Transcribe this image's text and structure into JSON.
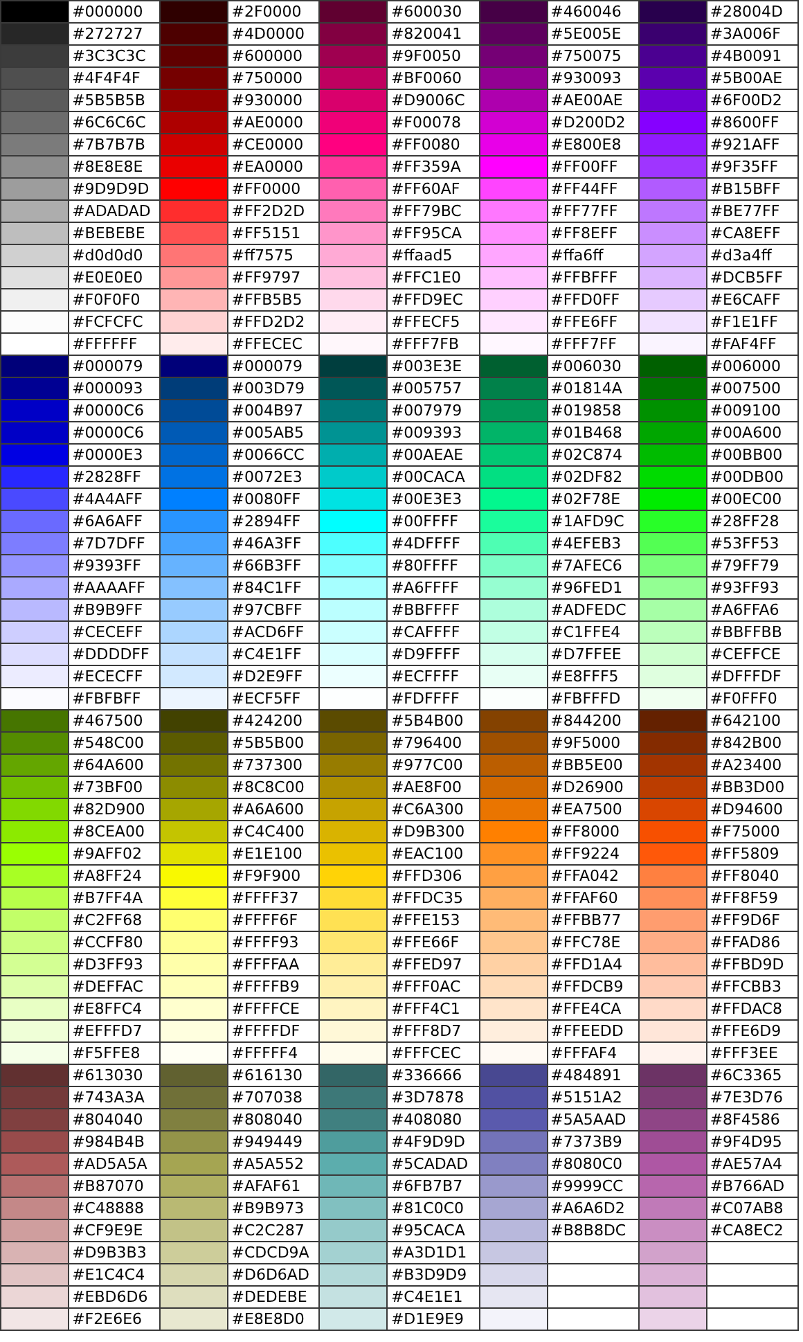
{
  "rows": [
    {
      "cells": [
        {
          "color": "#000000",
          "hex": "#000000"
        },
        {
          "color": "#2f0000",
          "hex": "#2F0000"
        },
        {
          "color": "#600030",
          "hex": "#600030"
        },
        {
          "color": "#460046",
          "hex": "#460046"
        },
        {
          "color": "#28004d",
          "hex": "#28004D"
        }
      ]
    },
    {
      "cells": [
        {
          "color": "#272727",
          "hex": "#272727"
        },
        {
          "color": "#4d0000",
          "hex": "#4D0000"
        },
        {
          "color": "#820041",
          "hex": "#820041"
        },
        {
          "color": "#5e005e",
          "hex": "#5E005E"
        },
        {
          "color": "#3a006f",
          "hex": "#3A006F"
        }
      ]
    },
    {
      "cells": [
        {
          "color": "#3c3c3c",
          "hex": "#3C3C3C"
        },
        {
          "color": "#600000",
          "hex": "#600000"
        },
        {
          "color": "#9f0050",
          "hex": "#9F0050"
        },
        {
          "color": "#750075",
          "hex": "#750075"
        },
        {
          "color": "#4b0091",
          "hex": "#4B0091"
        }
      ]
    },
    {
      "cells": [
        {
          "color": "#4f4f4f",
          "hex": "#4F4F4F"
        },
        {
          "color": "#750000",
          "hex": "#750000"
        },
        {
          "color": "#bf0060",
          "hex": "#BF0060"
        },
        {
          "color": "#930093",
          "hex": "#930093"
        },
        {
          "color": "#5b00ae",
          "hex": "#5B00AE"
        }
      ]
    },
    {
      "cells": [
        {
          "color": "#5b5b5b",
          "hex": "#5B5B5B"
        },
        {
          "color": "#930000",
          "hex": "#930000"
        },
        {
          "color": "#d9006c",
          "hex": "#D9006C"
        },
        {
          "color": "#ae00ae",
          "hex": "#AE00AE"
        },
        {
          "color": "#6f00d2",
          "hex": "#6F00D2"
        }
      ]
    },
    {
      "cells": [
        {
          "color": "#6c6c6c",
          "hex": "#6C6C6C"
        },
        {
          "color": "#ae0000",
          "hex": "#AE0000"
        },
        {
          "color": "#f00078",
          "hex": "#F00078"
        },
        {
          "color": "#d200d2",
          "hex": "#D200D2"
        },
        {
          "color": "#8600ff",
          "hex": "#8600FF"
        }
      ]
    },
    {
      "cells": [
        {
          "color": "#7b7b7b",
          "hex": "#7B7B7B"
        },
        {
          "color": "#ce0000",
          "hex": "#CE0000"
        },
        {
          "color": "#ff0080",
          "hex": "#FF0080"
        },
        {
          "color": "#e800e8",
          "hex": "#E800E8"
        },
        {
          "color": "#921aff",
          "hex": "#921AFF"
        }
      ]
    },
    {
      "cells": [
        {
          "color": "#8e8e8e",
          "hex": "#8E8E8E"
        },
        {
          "color": "#ea0000",
          "hex": "#EA0000"
        },
        {
          "color": "#ff359a",
          "hex": "#FF359A"
        },
        {
          "color": "#ff00ff",
          "hex": "#FF00FF"
        },
        {
          "color": "#9f35ff",
          "hex": "#9F35FF"
        }
      ]
    },
    {
      "cells": [
        {
          "color": "#9d9d9d",
          "hex": "#9D9D9D"
        },
        {
          "color": "#ff0000",
          "hex": "#FF0000"
        },
        {
          "color": "#ff60af",
          "hex": "#FF60AF"
        },
        {
          "color": "#ff44ff",
          "hex": "#FF44FF"
        },
        {
          "color": "#b15bff",
          "hex": "#B15BFF"
        }
      ]
    },
    {
      "cells": [
        {
          "color": "#adadad",
          "hex": "#ADADAD"
        },
        {
          "color": "#ff2d2d",
          "hex": "#FF2D2D"
        },
        {
          "color": "#ff79bc",
          "hex": "#FF79BC"
        },
        {
          "color": "#ff77ff",
          "hex": "#FF77FF"
        },
        {
          "color": "#be77ff",
          "hex": "#BE77FF"
        }
      ]
    },
    {
      "cells": [
        {
          "color": "#bebebe",
          "hex": "#BEBEBE"
        },
        {
          "color": "#ff5151",
          "hex": "#FF5151"
        },
        {
          "color": "#ff95ca",
          "hex": "#FF95CA"
        },
        {
          "color": "#ff8eff",
          "hex": "#FF8EFF"
        },
        {
          "color": "#ca8eff",
          "hex": "#CA8EFF"
        }
      ]
    },
    {
      "cells": [
        {
          "color": "#d0d0d0",
          "hex": "#d0d0d0"
        },
        {
          "color": "#ff7575",
          "hex": "#ff7575"
        },
        {
          "color": "#ffaad5",
          "hex": "#ffaad5"
        },
        {
          "color": "#ffa6ff",
          "hex": "#ffa6ff"
        },
        {
          "color": "#d3a4ff",
          "hex": "#d3a4ff"
        }
      ]
    },
    {
      "cells": [
        {
          "color": "#e0e0e0",
          "hex": "#E0E0E0"
        },
        {
          "color": "#ff9797",
          "hex": "#FF9797"
        },
        {
          "color": "#ffc1e0",
          "hex": "#FFC1E0"
        },
        {
          "color": "#ffbfff",
          "hex": "#FFBFFF"
        },
        {
          "color": "#dcb5ff",
          "hex": "#DCB5FF"
        }
      ]
    },
    {
      "cells": [
        {
          "color": "#f0f0f0",
          "hex": "#F0F0F0"
        },
        {
          "color": "#ffb5b5",
          "hex": "#FFB5B5"
        },
        {
          "color": "#ffd9ec",
          "hex": "#FFD9EC"
        },
        {
          "color": "#ffd0ff",
          "hex": "#FFD0FF"
        },
        {
          "color": "#e6caff",
          "hex": "#E6CAFF"
        }
      ]
    },
    {
      "cells": [
        {
          "color": "#fcfcfc",
          "hex": "#FCFCFC"
        },
        {
          "color": "#ffd2d2",
          "hex": "#FFD2D2"
        },
        {
          "color": "#ffecf5",
          "hex": "#FFECF5"
        },
        {
          "color": "#ffe6ff",
          "hex": "#FFE6FF"
        },
        {
          "color": "#f1e1ff",
          "hex": "#F1E1FF"
        }
      ]
    },
    {
      "cells": [
        {
          "color": "#ffffff",
          "hex": "#FFFFFF"
        },
        {
          "color": "#ffecec",
          "hex": "#FFECEC"
        },
        {
          "color": "#fff7fb",
          "hex": "#FFF7FB"
        },
        {
          "color": "#fff7ff",
          "hex": "#FFF7FF"
        },
        {
          "color": "#faf4ff",
          "hex": "#FAF4FF"
        }
      ]
    },
    {
      "cells": [
        {
          "color": "#000079",
          "hex": "#000079"
        },
        {
          "color": "#000079",
          "hex": "#000079"
        },
        {
          "color": "#003e3e",
          "hex": "#003E3E"
        },
        {
          "color": "#006030",
          "hex": "#006030"
        },
        {
          "color": "#006000",
          "hex": "#006000"
        }
      ]
    },
    {
      "cells": [
        {
          "color": "#000093",
          "hex": "#000093"
        },
        {
          "color": "#003d79",
          "hex": "#003D79"
        },
        {
          "color": "#005757",
          "hex": "#005757"
        },
        {
          "color": "#01814a",
          "hex": "#01814A"
        },
        {
          "color": "#007500",
          "hex": "#007500"
        }
      ]
    },
    {
      "cells": [
        {
          "color": "#0000c6",
          "hex": "#0000C6"
        },
        {
          "color": "#004b97",
          "hex": "#004B97"
        },
        {
          "color": "#007979",
          "hex": "#007979"
        },
        {
          "color": "#019858",
          "hex": "#019858"
        },
        {
          "color": "#009100",
          "hex": "#009100"
        }
      ]
    },
    {
      "cells": [
        {
          "color": "#0000c6",
          "hex": "#0000C6"
        },
        {
          "color": "#005ab5",
          "hex": "#005AB5"
        },
        {
          "color": "#009393",
          "hex": "#009393"
        },
        {
          "color": "#01b468",
          "hex": "#01B468"
        },
        {
          "color": "#00a600",
          "hex": "#00A600"
        }
      ]
    },
    {
      "cells": [
        {
          "color": "#0000e3",
          "hex": "#0000E3"
        },
        {
          "color": "#0066cc",
          "hex": "#0066CC"
        },
        {
          "color": "#00aeae",
          "hex": "#00AEAE"
        },
        {
          "color": "#02c874",
          "hex": "#02C874"
        },
        {
          "color": "#00bb00",
          "hex": "#00BB00"
        }
      ]
    },
    {
      "cells": [
        {
          "color": "#2828ff",
          "hex": "#2828FF"
        },
        {
          "color": "#0072e3",
          "hex": "#0072E3"
        },
        {
          "color": "#00caca",
          "hex": "#00CACA"
        },
        {
          "color": "#02df82",
          "hex": "#02DF82"
        },
        {
          "color": "#00db00",
          "hex": "#00DB00"
        }
      ]
    },
    {
      "cells": [
        {
          "color": "#4a4aff",
          "hex": "#4A4AFF"
        },
        {
          "color": "#0080ff",
          "hex": "#0080FF"
        },
        {
          "color": "#00e3e3",
          "hex": "#00E3E3"
        },
        {
          "color": "#02f78e",
          "hex": "#02F78E"
        },
        {
          "color": "#00ec00",
          "hex": "#00EC00"
        }
      ]
    },
    {
      "cells": [
        {
          "color": "#6a6aff",
          "hex": "#6A6AFF"
        },
        {
          "color": "#2894ff",
          "hex": "#2894FF"
        },
        {
          "color": "#00ffff",
          "hex": "#00FFFF"
        },
        {
          "color": "#1afd9c",
          "hex": "#1AFD9C"
        },
        {
          "color": "#28ff28",
          "hex": "#28FF28"
        }
      ]
    },
    {
      "cells": [
        {
          "color": "#7d7dff",
          "hex": "#7D7DFF"
        },
        {
          "color": "#46a3ff",
          "hex": "#46A3FF"
        },
        {
          "color": "#4dffff",
          "hex": "#4DFFFF"
        },
        {
          "color": "#4efeb3",
          "hex": "#4EFEB3"
        },
        {
          "color": "#53ff53",
          "hex": "#53FF53"
        }
      ]
    },
    {
      "cells": [
        {
          "color": "#9393ff",
          "hex": "#9393FF"
        },
        {
          "color": "#66b3ff",
          "hex": "#66B3FF"
        },
        {
          "color": "#80ffff",
          "hex": "#80FFFF"
        },
        {
          "color": "#7afec6",
          "hex": "#7AFEC6"
        },
        {
          "color": "#79ff79",
          "hex": "#79FF79"
        }
      ]
    },
    {
      "cells": [
        {
          "color": "#aaaaff",
          "hex": "#AAAAFF"
        },
        {
          "color": "#84c1ff",
          "hex": "#84C1FF"
        },
        {
          "color": "#a6ffff",
          "hex": "#A6FFFF"
        },
        {
          "color": "#96fed1",
          "hex": "#96FED1"
        },
        {
          "color": "#93ff93",
          "hex": "#93FF93"
        }
      ]
    },
    {
      "cells": [
        {
          "color": "#b9b9ff",
          "hex": "#B9B9FF"
        },
        {
          "color": "#97cbff",
          "hex": "#97CBFF"
        },
        {
          "color": "#bbffff",
          "hex": "#BBFFFF"
        },
        {
          "color": "#adfedc",
          "hex": "#ADFEDC"
        },
        {
          "color": "#a6ffa6",
          "hex": "#A6FFA6"
        }
      ]
    },
    {
      "cells": [
        {
          "color": "#ceceff",
          "hex": "#CECEFF"
        },
        {
          "color": "#acd6ff",
          "hex": "#ACD6FF"
        },
        {
          "color": "#caffff",
          "hex": "#CAFFFF"
        },
        {
          "color": "#c1ffe4",
          "hex": "#C1FFE4"
        },
        {
          "color": "#bbffbb",
          "hex": "#BBFFBB"
        }
      ]
    },
    {
      "cells": [
        {
          "color": "#ddddff",
          "hex": "#DDDDFF"
        },
        {
          "color": "#c4e1ff",
          "hex": "#C4E1FF"
        },
        {
          "color": "#d9ffff",
          "hex": "#D9FFFF"
        },
        {
          "color": "#d7ffee",
          "hex": "#D7FFEE"
        },
        {
          "color": "#ceffce",
          "hex": "#CEFFCE"
        }
      ]
    },
    {
      "cells": [
        {
          "color": "#ececff",
          "hex": "#ECECFF"
        },
        {
          "color": "#d2e9ff",
          "hex": "#D2E9FF"
        },
        {
          "color": "#ecffff",
          "hex": "#ECFFFF"
        },
        {
          "color": "#e8fff5",
          "hex": "#E8FFF5"
        },
        {
          "color": "#dfffdf",
          "hex": "#DFFFDF"
        }
      ]
    },
    {
      "cells": [
        {
          "color": "#fbfbff",
          "hex": "#FBFBFF"
        },
        {
          "color": "#ecf5ff",
          "hex": "#ECF5FF"
        },
        {
          "color": "#fdffff",
          "hex": "#FDFFFF"
        },
        {
          "color": "#fbfffd",
          "hex": "#FBFFFD"
        },
        {
          "color": "#f0fff0",
          "hex": "#F0FFF0"
        }
      ]
    },
    {
      "cells": [
        {
          "color": "#467500",
          "hex": "#467500"
        },
        {
          "color": "#424200",
          "hex": "#424200"
        },
        {
          "color": "#5b4b00",
          "hex": "#5B4B00"
        },
        {
          "color": "#844200",
          "hex": "#844200"
        },
        {
          "color": "#642100",
          "hex": "#642100"
        }
      ]
    },
    {
      "cells": [
        {
          "color": "#548c00",
          "hex": "#548C00"
        },
        {
          "color": "#5b5b00",
          "hex": "#5B5B00"
        },
        {
          "color": "#796400",
          "hex": "#796400"
        },
        {
          "color": "#9f5000",
          "hex": "#9F5000"
        },
        {
          "color": "#842b00",
          "hex": "#842B00"
        }
      ]
    },
    {
      "cells": [
        {
          "color": "#64a600",
          "hex": "#64A600"
        },
        {
          "color": "#737300",
          "hex": "#737300"
        },
        {
          "color": "#977c00",
          "hex": "#977C00"
        },
        {
          "color": "#bb5e00",
          "hex": "#BB5E00"
        },
        {
          "color": "#a23400",
          "hex": "#A23400"
        }
      ]
    },
    {
      "cells": [
        {
          "color": "#73bf00",
          "hex": "#73BF00"
        },
        {
          "color": "#8c8c00",
          "hex": "#8C8C00"
        },
        {
          "color": "#ae8f00",
          "hex": "#AE8F00"
        },
        {
          "color": "#d26900",
          "hex": "#D26900"
        },
        {
          "color": "#bb3d00",
          "hex": "#BB3D00"
        }
      ]
    },
    {
      "cells": [
        {
          "color": "#82d900",
          "hex": "#82D900"
        },
        {
          "color": "#a6a600",
          "hex": "#A6A600"
        },
        {
          "color": "#c6a300",
          "hex": "#C6A300"
        },
        {
          "color": "#ea7500",
          "hex": "#EA7500"
        },
        {
          "color": "#d94600",
          "hex": "#D94600"
        }
      ]
    },
    {
      "cells": [
        {
          "color": "#8cea00",
          "hex": "#8CEA00"
        },
        {
          "color": "#c4c400",
          "hex": "#C4C400"
        },
        {
          "color": "#d9b300",
          "hex": "#D9B300"
        },
        {
          "color": "#ff8000",
          "hex": "#FF8000"
        },
        {
          "color": "#f75000",
          "hex": "#F75000"
        }
      ]
    },
    {
      "cells": [
        {
          "color": "#9aff02",
          "hex": "#9AFF02"
        },
        {
          "color": "#e1e100",
          "hex": "#E1E100"
        },
        {
          "color": "#eac100",
          "hex": "#EAC100"
        },
        {
          "color": "#ff9224",
          "hex": "#FF9224"
        },
        {
          "color": "#ff5809",
          "hex": "#FF5809"
        }
      ]
    },
    {
      "cells": [
        {
          "color": "#a8ff24",
          "hex": "#A8FF24"
        },
        {
          "color": "#f9f900",
          "hex": "#F9F900"
        },
        {
          "color": "#ffd306",
          "hex": "#FFD306"
        },
        {
          "color": "#ffa042",
          "hex": "#FFA042"
        },
        {
          "color": "#ff8040",
          "hex": "#FF8040"
        }
      ]
    },
    {
      "cells": [
        {
          "color": "#b7ff4a",
          "hex": "#B7FF4A"
        },
        {
          "color": "#ffff37",
          "hex": "#FFFF37"
        },
        {
          "color": "#ffdc35",
          "hex": "#FFDC35"
        },
        {
          "color": "#ffaf60",
          "hex": "#FFAF60"
        },
        {
          "color": "#ff8f59",
          "hex": "#FF8F59"
        }
      ]
    },
    {
      "cells": [
        {
          "color": "#c2ff68",
          "hex": "#C2FF68"
        },
        {
          "color": "#ffff6f",
          "hex": "#FFFF6F"
        },
        {
          "color": "#ffe153",
          "hex": "#FFE153"
        },
        {
          "color": "#ffbb77",
          "hex": "#FFBB77"
        },
        {
          "color": "#ff9d6f",
          "hex": "#FF9D6F"
        }
      ]
    },
    {
      "cells": [
        {
          "color": "#ccff80",
          "hex": "#CCFF80"
        },
        {
          "color": "#ffff93",
          "hex": "#FFFF93"
        },
        {
          "color": "#ffe66f",
          "hex": "#FFE66F"
        },
        {
          "color": "#ffc78e",
          "hex": "#FFC78E"
        },
        {
          "color": "#ffad86",
          "hex": "#FFAD86"
        }
      ]
    },
    {
      "cells": [
        {
          "color": "#d3ff93",
          "hex": "#D3FF93"
        },
        {
          "color": "#ffffaa",
          "hex": "#FFFFAA"
        },
        {
          "color": "#ffed97",
          "hex": "#FFED97"
        },
        {
          "color": "#ffd1a4",
          "hex": "#FFD1A4"
        },
        {
          "color": "#ffbd9d",
          "hex": "#FFBD9D"
        }
      ]
    },
    {
      "cells": [
        {
          "color": "#deffac",
          "hex": "#DEFFAC"
        },
        {
          "color": "#ffffb9",
          "hex": "#FFFFB9"
        },
        {
          "color": "#fff0ac",
          "hex": "#FFF0AC"
        },
        {
          "color": "#ffdcb9",
          "hex": "#FFDCB9"
        },
        {
          "color": "#ffcbb3",
          "hex": "#FFCBB3"
        }
      ]
    },
    {
      "cells": [
        {
          "color": "#e8ffc4",
          "hex": "#E8FFC4"
        },
        {
          "color": "#ffffce",
          "hex": "#FFFFCE"
        },
        {
          "color": "#fff4c1",
          "hex": "#FFF4C1"
        },
        {
          "color": "#ffe4ca",
          "hex": "#FFE4CA"
        },
        {
          "color": "#ffdac8",
          "hex": "#FFDAC8"
        }
      ]
    },
    {
      "cells": [
        {
          "color": "#efffd7",
          "hex": "#EFFFD7"
        },
        {
          "color": "#ffffdf",
          "hex": "#FFFFDF"
        },
        {
          "color": "#fff8d7",
          "hex": "#FFF8D7"
        },
        {
          "color": "#ffeedd",
          "hex": "#FFEEDD"
        },
        {
          "color": "#ffe6d9",
          "hex": "#FFE6D9"
        }
      ]
    },
    {
      "cells": [
        {
          "color": "#f5ffe8",
          "hex": "#F5FFE8"
        },
        {
          "color": "#fffff4",
          "hex": "#FFFFF4"
        },
        {
          "color": "#fffcec",
          "hex": "#FFFCEC"
        },
        {
          "color": "#fffaf4",
          "hex": "#FFFAF4"
        },
        {
          "color": "#fff3ee",
          "hex": "#FFF3EE"
        }
      ]
    },
    {
      "cells": [
        {
          "color": "#613030",
          "hex": "#613030"
        },
        {
          "color": "#616130",
          "hex": "#616130"
        },
        {
          "color": "#336666",
          "hex": "#336666"
        },
        {
          "color": "#484891",
          "hex": "#484891"
        },
        {
          "color": "#6c3365",
          "hex": "#6C3365"
        }
      ]
    },
    {
      "cells": [
        {
          "color": "#743a3a",
          "hex": "#743A3A"
        },
        {
          "color": "#707038",
          "hex": "#707038"
        },
        {
          "color": "#3d7878",
          "hex": "#3D7878"
        },
        {
          "color": "#5151a2",
          "hex": "#5151A2"
        },
        {
          "color": "#7e3d76",
          "hex": "#7E3D76"
        }
      ]
    },
    {
      "cells": [
        {
          "color": "#804040",
          "hex": "#804040"
        },
        {
          "color": "#808040",
          "hex": "#808040"
        },
        {
          "color": "#408080",
          "hex": "#408080"
        },
        {
          "color": "#5a5aad",
          "hex": "#5A5AAD"
        },
        {
          "color": "#8f4586",
          "hex": "#8F4586"
        }
      ]
    },
    {
      "cells": [
        {
          "color": "#984b4b",
          "hex": "#984B4B"
        },
        {
          "color": "#949449",
          "hex": "#949449"
        },
        {
          "color": "#4f9d9d",
          "hex": "#4F9D9D"
        },
        {
          "color": "#7373b9",
          "hex": "#7373B9"
        },
        {
          "color": "#9f4d95",
          "hex": "#9F4D95"
        }
      ]
    },
    {
      "cells": [
        {
          "color": "#ad5a5a",
          "hex": "#AD5A5A"
        },
        {
          "color": "#a5a552",
          "hex": "#A5A552"
        },
        {
          "color": "#5cadad",
          "hex": "#5CADAD"
        },
        {
          "color": "#8080c0",
          "hex": "#8080C0"
        },
        {
          "color": "#ae57a4",
          "hex": "#AE57A4"
        }
      ]
    },
    {
      "cells": [
        {
          "color": "#b87070",
          "hex": "#B87070"
        },
        {
          "color": "#afaf61",
          "hex": "#AFAF61"
        },
        {
          "color": "#6fb7b7",
          "hex": "#6FB7B7"
        },
        {
          "color": "#9999cc",
          "hex": "#9999CC"
        },
        {
          "color": "#b766ad",
          "hex": "#B766AD"
        }
      ]
    },
    {
      "cells": [
        {
          "color": "#c48888",
          "hex": "#C48888"
        },
        {
          "color": "#b9b973",
          "hex": "#B9B973"
        },
        {
          "color": "#81c0c0",
          "hex": "#81C0C0"
        },
        {
          "color": "#a6a6d2",
          "hex": "#A6A6D2"
        },
        {
          "color": "#c07ab8",
          "hex": "#C07AB8"
        }
      ]
    },
    {
      "cells": [
        {
          "color": "#cf9e9e",
          "hex": "#CF9E9E"
        },
        {
          "color": "#c2c287",
          "hex": "#C2C287"
        },
        {
          "color": "#95caca",
          "hex": "#95CACA"
        },
        {
          "color": "#b8b8dc",
          "hex": "#B8B8DC"
        },
        {
          "color": "#ca8ec2",
          "hex": "#CA8EC2"
        }
      ]
    },
    {
      "cells": [
        {
          "color": "#d9b3b3",
          "hex": "#D9B3B3"
        },
        {
          "color": "#cdcd9a",
          "hex": "#CDCD9A"
        },
        {
          "color": "#a3d1d1",
          "hex": "#A3D1D1"
        },
        {
          "color": "#c7c7e2"
        },
        {
          "color": "#d2a2cb"
        }
      ]
    },
    {
      "cells": [
        {
          "color": "#e1c4c4",
          "hex": "#E1C4C4"
        },
        {
          "color": "#d6d6ad",
          "hex": "#D6D6AD"
        },
        {
          "color": "#b3d9d9",
          "hex": "#B3D9D9"
        },
        {
          "color": "#d8d8eb"
        },
        {
          "color": "#dab1d5"
        }
      ]
    },
    {
      "cells": [
        {
          "color": "#ebd6d6",
          "hex": "#EBD6D6"
        },
        {
          "color": "#dedebe",
          "hex": "#DEDEBE"
        },
        {
          "color": "#c4e1e1",
          "hex": "#C4E1E1"
        },
        {
          "color": "#e6e6f2"
        },
        {
          "color": "#e2c1de"
        }
      ]
    },
    {
      "cells": [
        {
          "color": "#f2e6e6",
          "hex": "#F2E6E6"
        },
        {
          "color": "#e8e8d0",
          "hex": "#E8E8D0"
        },
        {
          "color": "#d1e9e9",
          "hex": "#D1E9E9"
        },
        {
          "color": "#f3f3fa"
        },
        {
          "color": "#ebd3e8"
        }
      ]
    }
  ]
}
